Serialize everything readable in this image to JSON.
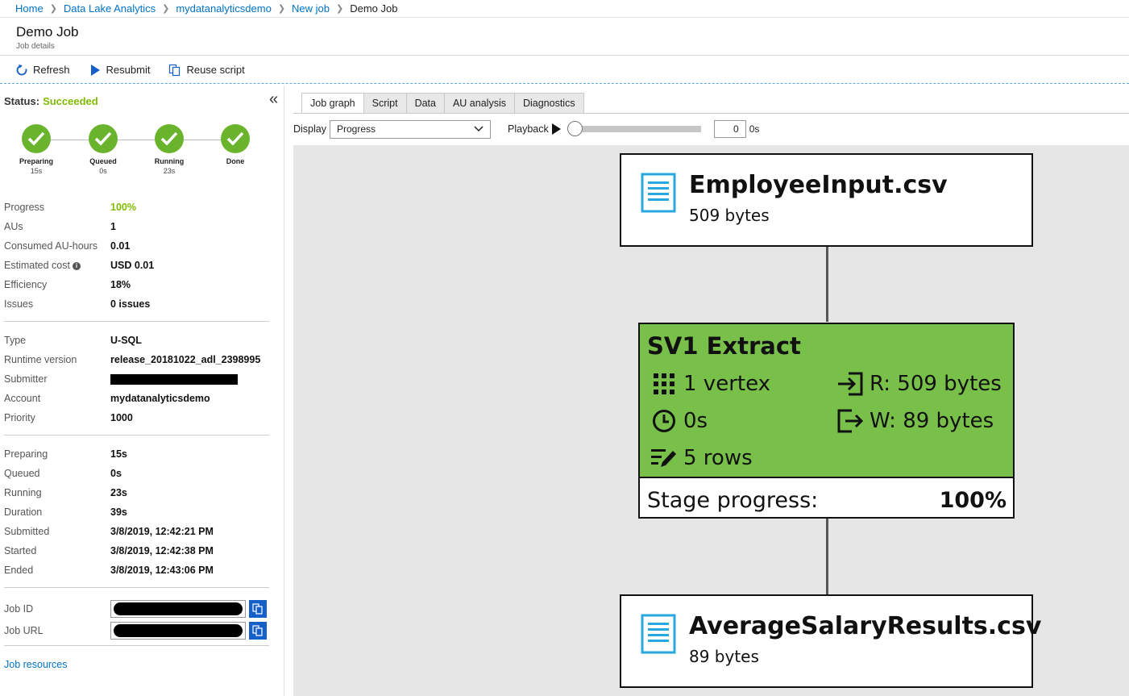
{
  "breadcrumb": [
    "Home",
    "Data Lake Analytics",
    "mydatanalyticsdemo",
    "New job",
    "Demo Job"
  ],
  "page": {
    "title": "Demo Job",
    "subtitle": "Job details"
  },
  "toolbar": {
    "refresh": "Refresh",
    "resubmit": "Resubmit",
    "reuse_script": "Reuse script"
  },
  "status": {
    "label": "Status:",
    "value": "Succeeded",
    "color": "#7fba00"
  },
  "steps": [
    {
      "label": "Preparing",
      "time": "15s"
    },
    {
      "label": "Queued",
      "time": "0s"
    },
    {
      "label": "Running",
      "time": "23s"
    },
    {
      "label": "Done",
      "time": ""
    }
  ],
  "summary": [
    {
      "key": "Progress",
      "value": "100%"
    },
    {
      "key": "AUs",
      "value": "1"
    },
    {
      "key": "Consumed AU-hours",
      "value": "0.01"
    },
    {
      "key": "Estimated cost",
      "value": "USD 0.01"
    },
    {
      "key": "Efficiency",
      "value": "18%"
    },
    {
      "key": "Issues",
      "value": "0 issues"
    }
  ],
  "details": [
    {
      "key": "Type",
      "value": "U-SQL"
    },
    {
      "key": "Runtime version",
      "value": "release_20181022_adl_2398995"
    },
    {
      "key": "Submitter",
      "value": ""
    },
    {
      "key": "Account",
      "value": "mydatanalyticsdemo"
    },
    {
      "key": "Priority",
      "value": "1000"
    }
  ],
  "timing": [
    {
      "key": "Preparing",
      "value": "15s"
    },
    {
      "key": "Queued",
      "value": "0s"
    },
    {
      "key": "Running",
      "value": "23s"
    },
    {
      "key": "Duration",
      "value": "39s"
    },
    {
      "key": "Submitted",
      "value": "3/8/2019, 12:42:21 PM"
    },
    {
      "key": "Started",
      "value": "3/8/2019, 12:42:38 PM"
    },
    {
      "key": "Ended",
      "value": "3/8/2019, 12:43:06 PM"
    }
  ],
  "ids": [
    {
      "key": "Job ID"
    },
    {
      "key": "Job URL"
    }
  ],
  "job_resources": "Job resources",
  "tabs": [
    "Job graph",
    "Script",
    "Data",
    "AU analysis",
    "Diagnostics"
  ],
  "display": {
    "label": "Display",
    "selected": "Progress"
  },
  "playback": {
    "label": "Playback",
    "value": "0",
    "unit": "0s",
    "position": 0
  },
  "graph": {
    "input": {
      "name": "EmployeeInput.csv",
      "size": "509 bytes"
    },
    "stage": {
      "title": "SV1 Extract",
      "vertices": "1 vertex",
      "time": "0s",
      "rows": "5 rows",
      "read": "R: 509 bytes",
      "write": "W: 89 bytes",
      "progress_label": "Stage progress:",
      "progress_value": "100%",
      "progress": 1.0,
      "color": "#79c04a"
    },
    "output": {
      "name": "AverageSalaryResults.csv",
      "size": "89 bytes"
    }
  }
}
